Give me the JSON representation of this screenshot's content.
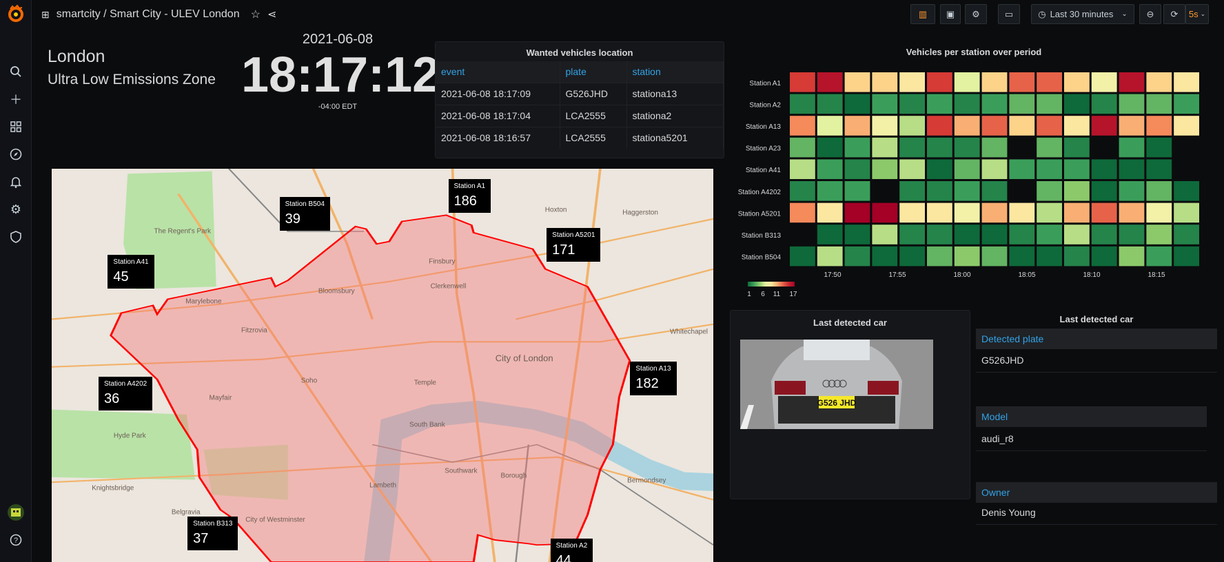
{
  "topbar": {
    "breadcrumb": "smartcity / Smart City - ULEV London",
    "time_range": "Last 30 minutes",
    "refresh_interval": "5s"
  },
  "sidebar": {
    "items": [
      "grafana-logo",
      "search",
      "create",
      "dashboards",
      "explore",
      "alerting",
      "configuration",
      "server-admin"
    ],
    "bottom": [
      "user-avatar",
      "help"
    ]
  },
  "header": {
    "city": "London",
    "subtitle": "Ultra Low Emissions Zone"
  },
  "clock": {
    "date": "2021-06-08",
    "time": "18:17:12",
    "timezone": "-04:00 EDT"
  },
  "wanted": {
    "title": "Wanted vehicles location",
    "columns": [
      "event",
      "plate",
      "station"
    ],
    "rows": [
      [
        "2021-06-08 18:17:09",
        "G526JHD",
        "stationa13"
      ],
      [
        "2021-06-08 18:17:04",
        "LCA2555",
        "stationa2"
      ],
      [
        "2021-06-08 18:16:57",
        "LCA2555",
        "stationa5201"
      ]
    ]
  },
  "chart_data": {
    "type": "heatmap",
    "title": "Vehicles per station over period",
    "rows": [
      "Station A1",
      "Station A2",
      "Station A13",
      "Station A23",
      "Station A41",
      "Station A4202",
      "Station A5201",
      "Station B313",
      "Station B504"
    ],
    "x_ticks": [
      "17:50",
      "17:55",
      "18:00",
      "18:05",
      "18:10",
      "18:15"
    ],
    "color_scale": {
      "min": 1,
      "max": 17,
      "ticks": [
        "1",
        "6",
        "11",
        "17"
      ],
      "scheme": "RdYlGn reversed"
    },
    "values": [
      [
        14,
        16,
        10,
        10,
        9,
        14,
        7,
        10,
        13,
        13,
        10,
        8,
        16,
        10,
        9
      ],
      [
        2,
        2,
        1,
        3,
        2,
        3,
        2,
        3,
        4,
        4,
        1,
        2,
        4,
        4,
        3
      ],
      [
        12,
        7,
        11,
        8,
        6,
        14,
        11,
        13,
        10,
        13,
        9,
        16,
        11,
        12,
        9
      ],
      [
        4,
        1,
        3,
        6,
        2,
        2,
        2,
        4,
        null,
        4,
        2,
        null,
        3,
        1,
        null
      ],
      [
        6,
        3,
        2,
        5,
        6,
        1,
        4,
        6,
        3,
        3,
        3,
        1,
        1,
        1,
        null
      ],
      [
        2,
        3,
        3,
        null,
        2,
        2,
        3,
        2,
        null,
        4,
        5,
        1,
        3,
        4,
        1
      ],
      [
        12,
        9,
        17,
        17,
        9,
        9,
        8,
        11,
        9,
        6,
        11,
        13,
        11,
        8,
        6
      ],
      [
        null,
        1,
        1,
        6,
        2,
        2,
        1,
        1,
        2,
        3,
        6,
        2,
        2,
        5,
        2
      ],
      [
        1,
        6,
        2,
        1,
        1,
        4,
        5,
        4,
        1,
        1,
        2,
        1,
        5,
        3,
        1
      ]
    ]
  },
  "car_image": {
    "title": "Last detected car",
    "plate_text": "G526 JHD"
  },
  "car_details": {
    "title": "Last detected car",
    "fields": [
      {
        "label": "Detected plate",
        "value": "G526JHD"
      },
      {
        "label": "Model",
        "value": "audi_r8"
      },
      {
        "label": "Owner",
        "value": "Denis Young"
      }
    ]
  },
  "map": {
    "stations": [
      {
        "name": "Station A1",
        "count": "186"
      },
      {
        "name": "Station B504",
        "count": "39"
      },
      {
        "name": "Station A5201",
        "count": "171"
      },
      {
        "name": "Station A41",
        "count": "45"
      },
      {
        "name": "Station A4202",
        "count": "36"
      },
      {
        "name": "Station A13",
        "count": "182"
      },
      {
        "name": "Station B313",
        "count": "37"
      },
      {
        "name": "Station A2",
        "count": "44"
      }
    ],
    "labels": [
      "City of London",
      "Whitechapel",
      "Hyde Park",
      "The Regent's Park",
      "Clerkenwell",
      "Bloomsbury",
      "Mayfair",
      "Soho",
      "Southwark",
      "Borough",
      "Bermondsey",
      "Knightsbridge",
      "Belgravia",
      "City of Westminster",
      "Hoxton",
      "Haggerston",
      "Temple",
      "Lambeth",
      "South Bank",
      "Marylebone",
      "Fitzrovia",
      "Finsbury"
    ],
    "zone_color": "#ff0000"
  },
  "colors": {
    "accent": "#33a2e5",
    "refresh": "#ff9830",
    "logo": "#f46800"
  }
}
